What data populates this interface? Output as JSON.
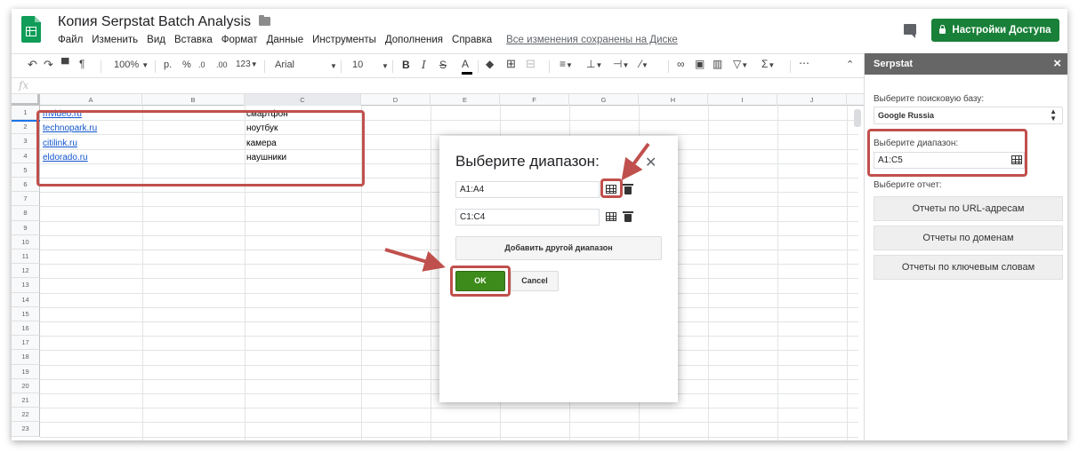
{
  "header": {
    "doc_title": "Копия Serpstat Batch Analysis",
    "menu": [
      "Файл",
      "Изменить",
      "Вид",
      "Вставка",
      "Формат",
      "Данные",
      "Инструменты",
      "Дополнения",
      "Справка"
    ],
    "saved_status": "Все изменения сохранены на Диске",
    "share_label": "Настройки Доступа",
    "brand_color": "#188038"
  },
  "toolbar": {
    "zoom": "100%",
    "currency": "р.",
    "percent": "%",
    "dec_decrease": ".0",
    "dec_increase": ".00",
    "number_format": "123",
    "font": "Arial",
    "font_size": "10",
    "bold": "B",
    "italic": "I",
    "strike": "S",
    "text_color": "A"
  },
  "formula_bar": {
    "fx": "fx"
  },
  "columns": [
    "A",
    "B",
    "C",
    "D",
    "E",
    "F",
    "G",
    "H",
    "I",
    "J"
  ],
  "rows": [
    "1",
    "2",
    "3",
    "4",
    "5",
    "6",
    "7",
    "8",
    "9",
    "10",
    "11",
    "12",
    "13",
    "14",
    "15",
    "16",
    "17",
    "18",
    "19",
    "20",
    "21",
    "22",
    "23"
  ],
  "cells": {
    "a": [
      " mvideo.ru",
      "technopark.ru",
      "citilink.ru",
      "eldorado.ru"
    ],
    "c": [
      "смартфон",
      "ноутбук",
      "камера",
      "наушники"
    ]
  },
  "dialog": {
    "title": "Выберите диапазон:",
    "range1": "A1:A4",
    "range2": "C1:C4",
    "add_range": "Добавить другой диапазон",
    "ok": "OK",
    "cancel": "Cancel"
  },
  "sidebar": {
    "title": "Serpstat",
    "db_label": "Выберите поисковую базу:",
    "db_value": "Google Russia",
    "range_label": "Выберите диапазон:",
    "range_value": "A1:C5",
    "report_label": "Выберите отчет:",
    "buttons": [
      "Отчеты по URL-адресам",
      "Отчеты по доменам",
      "Отчеты по ключевым словам"
    ]
  },
  "annotation_color": "#c0504d"
}
